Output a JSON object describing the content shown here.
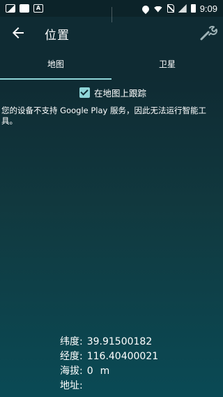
{
  "status_bar": {
    "time": "9:09",
    "a_icon_text": "A",
    "left_icons": [
      "image-icon",
      "square-icon",
      "a-icon"
    ],
    "right_icons": [
      "location-icon",
      "wifi-icon",
      "no-sim-icon",
      "signal-icon",
      "battery-icon"
    ]
  },
  "app_bar": {
    "title": "位置",
    "back_icon": "arrow-left-icon",
    "tools_icon": "wrench-icon"
  },
  "tabs": [
    {
      "label": "地图",
      "selected": true
    },
    {
      "label": "卫星",
      "selected": false
    }
  ],
  "follow_on_map": {
    "label": "在地图上跟踪",
    "checked": true
  },
  "play_services_warning": "您的设备不支持 Google Play 服务，因此无法运行智能工具。",
  "info": {
    "latitude_label": "纬度:",
    "latitude_value": "39.91500182",
    "longitude_label": "经度:",
    "longitude_value": "116.40400021",
    "altitude_label": "海拔:",
    "altitude_value": "0",
    "altitude_unit": "m",
    "address_label": "地址:",
    "address_value": ""
  },
  "colors": {
    "accent": "#8fd5d8",
    "background_top": "#0f2b33",
    "background_bottom": "#0a4a55",
    "status_bar": "#0c2329"
  }
}
